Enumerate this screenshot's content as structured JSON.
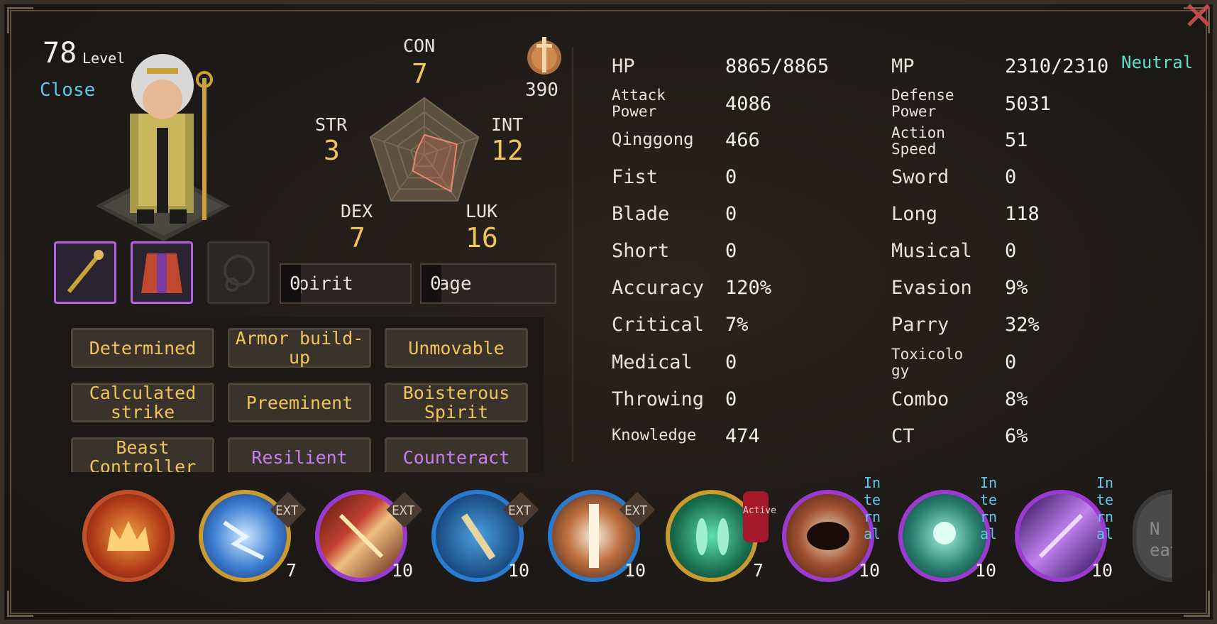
{
  "header": {
    "level": "78",
    "level_word": "Level",
    "close_label": "Close",
    "close_icon": "close-x-icon",
    "alignment": "Neutral"
  },
  "attributes": {
    "con": {
      "label": "CON",
      "value": "7"
    },
    "str": {
      "label": "STR",
      "value": "3"
    },
    "int": {
      "label": "INT",
      "value": "12"
    },
    "dex": {
      "label": "DEX",
      "value": "7"
    },
    "luk": {
      "label": "LUK",
      "value": "16"
    },
    "radar_levels": {
      "con": 7,
      "int": 12,
      "luk": 16,
      "dex": 7,
      "str": 3
    }
  },
  "seal": {
    "icon": "sword-medal-icon",
    "value": "390"
  },
  "meters": {
    "spirit": {
      "label": "Spirit",
      "value": "0"
    },
    "rage": {
      "label": "Rage",
      "value": "0"
    }
  },
  "equipment": [
    {
      "icon": "staff-icon",
      "filled": true
    },
    {
      "icon": "robe-icon",
      "filled": true
    },
    {
      "icon": "necklace-icon",
      "filled": false
    }
  ],
  "traits": [
    {
      "label": "Determined",
      "color": "gold"
    },
    {
      "label": "Armor build-up",
      "color": "gold"
    },
    {
      "label": "Unmovable",
      "color": "gold"
    },
    {
      "label": "Calculated strike",
      "color": "gold"
    },
    {
      "label": "Preeminent",
      "color": "gold"
    },
    {
      "label": "Boisterous Spirit",
      "color": "gold"
    },
    {
      "label": "Beast Controller",
      "color": "gold"
    },
    {
      "label": "Resilient",
      "color": "purple"
    },
    {
      "label": "Counteract",
      "color": "purple"
    }
  ],
  "stats_left": [
    {
      "label": "HP",
      "value": "8865/8865"
    },
    {
      "label": "Attack Power",
      "value": "4086"
    },
    {
      "label": "Qinggong",
      "value": "466"
    },
    {
      "label": "Fist",
      "value": "0"
    },
    {
      "label": "Blade",
      "value": "0"
    },
    {
      "label": "Short",
      "value": "0"
    },
    {
      "label": "Accuracy",
      "value": "120%"
    },
    {
      "label": "Critical",
      "value": "7%"
    },
    {
      "label": "Medical",
      "value": "0"
    },
    {
      "label": "Throwing",
      "value": "0"
    },
    {
      "label": "Knowledge",
      "value": "474"
    }
  ],
  "stats_right": [
    {
      "label": "MP",
      "value": "2310/2310"
    },
    {
      "label": "Defense Power",
      "value": "5031"
    },
    {
      "label": "Action Speed",
      "value": "51"
    },
    {
      "label": "Sword",
      "value": "0"
    },
    {
      "label": "Long",
      "value": "118"
    },
    {
      "label": "Musical",
      "value": "0"
    },
    {
      "label": "Evasion",
      "value": "9%"
    },
    {
      "label": "Parry",
      "value": "32%"
    },
    {
      "label": "Toxicology",
      "value": "0"
    },
    {
      "label": "Combo",
      "value": "8%"
    },
    {
      "label": "CT",
      "value": "6%"
    }
  ],
  "skills": [
    {
      "icon": "flame-crown-icon",
      "level": "",
      "tag": ""
    },
    {
      "icon": "lightning-icon",
      "level": "7",
      "tag": "EXT"
    },
    {
      "icon": "slash-icon",
      "level": "10",
      "tag": "EXT"
    },
    {
      "icon": "flute-icon",
      "level": "10",
      "tag": "EXT"
    },
    {
      "icon": "strike-icon",
      "level": "10",
      "tag": "EXT"
    },
    {
      "icon": "leaf-blades-icon",
      "level": "7",
      "tag": "Active"
    },
    {
      "icon": "maw-icon",
      "level": "10",
      "tag": "Internal"
    },
    {
      "icon": "spirit-icon",
      "level": "10",
      "tag": "Internal"
    },
    {
      "icon": "violet-slash-icon",
      "level": "10",
      "tag": "Internal"
    },
    {
      "icon": "locked-skill-icon",
      "level": "",
      "tag": "N eat"
    }
  ],
  "colors": {
    "gold": "#f0c45a",
    "purple": "#c77cf0",
    "cyan": "#5ec6e8",
    "teal": "#5ee0c8",
    "danger": "#c04a4a"
  }
}
